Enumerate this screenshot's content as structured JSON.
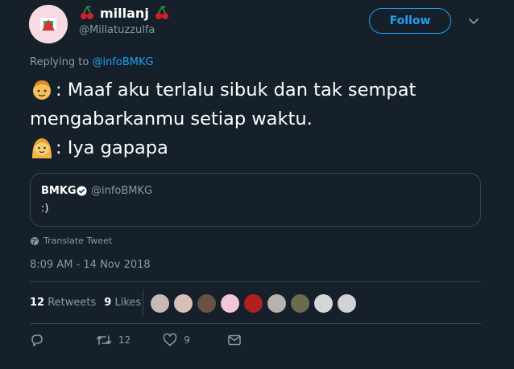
{
  "author": {
    "name": "millanj",
    "handle": "@Millatuzzulfa",
    "name_emoji": "cherries-icon"
  },
  "follow_label": "Follow",
  "replying": {
    "prefix": "Replying to",
    "handle": "@infoBMKG"
  },
  "tweet_lines": [
    {
      "emoji": "boy-emoji",
      "text": ": Maaf aku terlalu sibuk dan tak sempat"
    },
    {
      "emoji": "",
      "text": "mengabarkanmu setiap waktu."
    },
    {
      "emoji": "girl-emoji",
      "text": ": Iya gapapa"
    }
  ],
  "quoted": {
    "name": "BMKG",
    "handle": "@infoBMKG",
    "text": ":)"
  },
  "translate_label": "Translate Tweet",
  "timestamp": "8:09 AM - 14 Nov 2018",
  "stats": {
    "retweets_count": "12",
    "retweets_label": "Retweets",
    "likes_count": "9",
    "likes_label": "Likes"
  },
  "likers": [
    "#c9b8b4",
    "#d8c0b8",
    "#6b5044",
    "#f3c5d5",
    "#b02020",
    "#b9b1ad",
    "#6e6a52",
    "#d6d6d6",
    "#d2d2d2"
  ],
  "actions": {
    "retweet_count": "12",
    "like_count": "9"
  },
  "colors": {
    "background": "#15202b",
    "accent": "#1da1f2",
    "muted": "#8899a6",
    "border": "#38444d"
  }
}
